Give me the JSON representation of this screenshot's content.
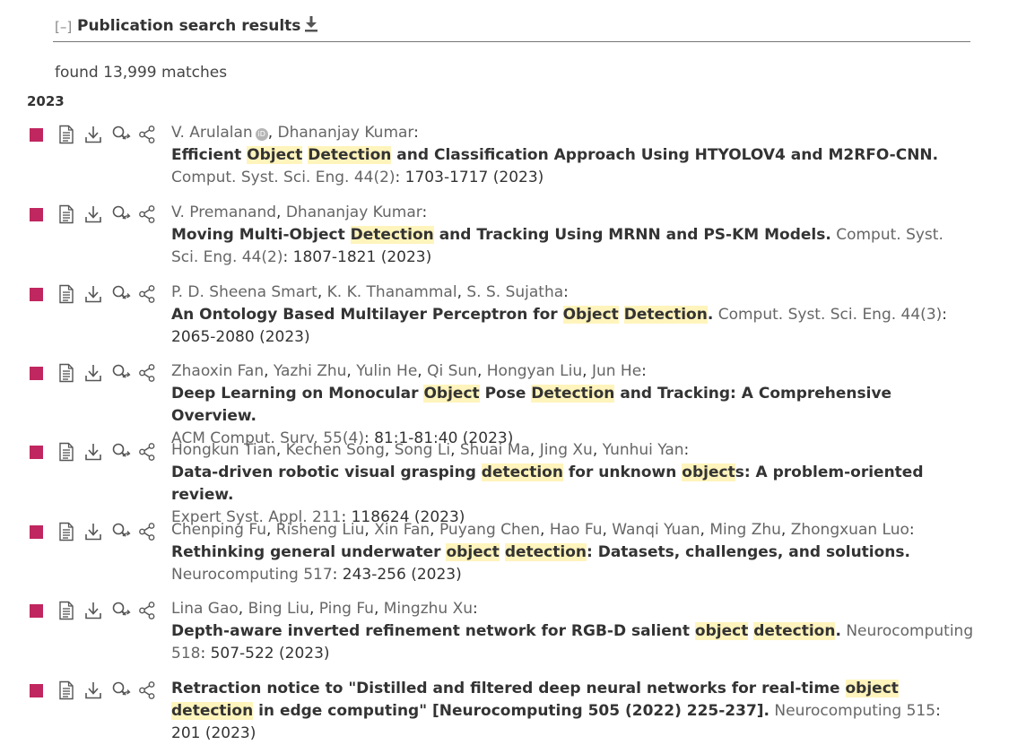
{
  "header": {
    "toggle": "[–]",
    "title": "Publication search results"
  },
  "count_text": "found 13,999 matches",
  "year": "2023",
  "icons": {
    "marker": "journal-article-marker",
    "tools": [
      "document-icon",
      "download-icon",
      "search-link-icon",
      "share-icon"
    ],
    "header_download": "download-icon",
    "orcid": "orcid-icon"
  },
  "colors": {
    "marker": "#c0265f",
    "highlight": "#fff4bc"
  },
  "entries": [
    {
      "authors": [
        {
          "name": "V. Arulalan",
          "sep": "",
          "orcid": true
        },
        {
          "name": "Dhananjay Kumar",
          "sep": ", ",
          "orcid": false
        }
      ],
      "title_parts": [
        {
          "t": "Efficient ",
          "hl": false
        },
        {
          "t": "Object",
          "hl": true
        },
        {
          "t": " ",
          "hl": false
        },
        {
          "t": "Detection",
          "hl": true
        },
        {
          "t": " and Classification Approach Using HTYOLOV4 and M2RFO-CNN.",
          "hl": false
        }
      ],
      "title_break": true,
      "venue": "Comput. Syst. Sci. Eng. 44(2)",
      "pages": ": 1703-1717 (2023)"
    },
    {
      "authors": [
        {
          "name": "V. Premanand",
          "sep": "",
          "orcid": false
        },
        {
          "name": "Dhananjay Kumar",
          "sep": ", ",
          "orcid": false
        }
      ],
      "title_parts": [
        {
          "t": "Moving Multi-Object ",
          "hl": false
        },
        {
          "t": "Detection",
          "hl": true
        },
        {
          "t": " and Tracking Using MRNN and PS-KM Models.",
          "hl": false
        }
      ],
      "title_break": false,
      "venue": "Comput. Syst. Sci. Eng. 44(2)",
      "pages": ": 1807-1821 (2023)"
    },
    {
      "authors": [
        {
          "name": "P. D. Sheena Smart",
          "sep": "",
          "orcid": false
        },
        {
          "name": "K. K. Thanammal",
          "sep": ", ",
          "orcid": false
        },
        {
          "name": "S. S. Sujatha",
          "sep": ", ",
          "orcid": false
        }
      ],
      "title_parts": [
        {
          "t": "An Ontology Based Multilayer Perceptron for ",
          "hl": false
        },
        {
          "t": "Object",
          "hl": true
        },
        {
          "t": " ",
          "hl": false
        },
        {
          "t": "Detection",
          "hl": true
        },
        {
          "t": ".",
          "hl": false
        }
      ],
      "title_break": false,
      "venue": "Comput. Syst. Sci. Eng. 44(3)",
      "pages": ": 2065-2080 (2023)"
    },
    {
      "authors": [
        {
          "name": "Zhaoxin Fan",
          "sep": "",
          "orcid": false
        },
        {
          "name": "Yazhi Zhu",
          "sep": ", ",
          "orcid": false
        },
        {
          "name": "Yulin He",
          "sep": ", ",
          "orcid": false
        },
        {
          "name": "Qi Sun",
          "sep": ", ",
          "orcid": false
        },
        {
          "name": "Hongyan Liu",
          "sep": ", ",
          "orcid": false
        },
        {
          "name": "Jun He",
          "sep": ", ",
          "orcid": false
        }
      ],
      "title_parts": [
        {
          "t": "Deep Learning on Monocular ",
          "hl": false
        },
        {
          "t": "Object",
          "hl": true
        },
        {
          "t": " Pose ",
          "hl": false
        },
        {
          "t": "Detection",
          "hl": true
        },
        {
          "t": " and Tracking: A Comprehensive Overview.",
          "hl": false
        }
      ],
      "title_break": true,
      "venue": "ACM Comput. Surv. 55(4)",
      "pages": ": 81:1-81:40 (2023)"
    },
    {
      "authors": [
        {
          "name": "Hongkun Tian",
          "sep": "",
          "orcid": false
        },
        {
          "name": "Kechen Song",
          "sep": ", ",
          "orcid": false
        },
        {
          "name": "Song Li",
          "sep": ", ",
          "orcid": false
        },
        {
          "name": "Shuai Ma",
          "sep": ", ",
          "orcid": false
        },
        {
          "name": "Jing Xu",
          "sep": ", ",
          "orcid": false
        },
        {
          "name": "Yunhui Yan",
          "sep": ", ",
          "orcid": false
        }
      ],
      "title_parts": [
        {
          "t": "Data-driven robotic visual grasping ",
          "hl": false
        },
        {
          "t": "detection",
          "hl": true
        },
        {
          "t": " for unknown ",
          "hl": false
        },
        {
          "t": "object",
          "hl": true
        },
        {
          "t": "s: A problem-oriented review.",
          "hl": false
        }
      ],
      "title_break": true,
      "venue": "Expert Syst. Appl. 211",
      "pages": ": 118624 (2023)"
    },
    {
      "authors": [
        {
          "name": "Chenping Fu",
          "sep": "",
          "orcid": false
        },
        {
          "name": "Risheng Liu",
          "sep": ", ",
          "orcid": false
        },
        {
          "name": "Xin Fan",
          "sep": ", ",
          "orcid": false
        },
        {
          "name": "Puyang Chen",
          "sep": ", ",
          "orcid": false
        },
        {
          "name": "Hao Fu",
          "sep": ", ",
          "orcid": false
        },
        {
          "name": "Wanqi Yuan",
          "sep": ", ",
          "orcid": false
        },
        {
          "name": "Ming Zhu",
          "sep": ", ",
          "orcid": false
        },
        {
          "name": "Zhongxuan Luo",
          "sep": ", ",
          "orcid": false
        }
      ],
      "title_parts": [
        {
          "t": "Rethinking general underwater ",
          "hl": false
        },
        {
          "t": "object",
          "hl": true
        },
        {
          "t": " ",
          "hl": false
        },
        {
          "t": "detection",
          "hl": true
        },
        {
          "t": ": Datasets, challenges, and solutions.",
          "hl": false
        }
      ],
      "title_break": true,
      "venue": "Neurocomputing 517",
      "pages": ": 243-256 (2023)"
    },
    {
      "authors": [
        {
          "name": "Lina Gao",
          "sep": "",
          "orcid": false
        },
        {
          "name": "Bing Liu",
          "sep": ", ",
          "orcid": false
        },
        {
          "name": "Ping Fu",
          "sep": ", ",
          "orcid": false
        },
        {
          "name": "Mingzhu Xu",
          "sep": ", ",
          "orcid": false
        }
      ],
      "title_parts": [
        {
          "t": "Depth-aware inverted refinement network for RGB-D salient ",
          "hl": false
        },
        {
          "t": "object",
          "hl": true
        },
        {
          "t": " ",
          "hl": false
        },
        {
          "t": "detection",
          "hl": true
        },
        {
          "t": ".",
          "hl": false
        }
      ],
      "title_break": false,
      "venue": "Neurocomputing 518",
      "pages": ": 507-522 (2023)"
    },
    {
      "authors": [],
      "title_parts": [
        {
          "t": "Retraction notice to \"Distilled and filtered deep neural networks for real-time ",
          "hl": false
        },
        {
          "t": "object",
          "hl": true
        },
        {
          "t": " ",
          "hl": false
        },
        {
          "t": "detection",
          "hl": true
        },
        {
          "t": " in edge computing\" [Neurocomputing 505 (2022) 225-237].",
          "hl": false
        }
      ],
      "title_break": false,
      "venue": "Neurocomputing 515",
      "pages": ": 201 (2023)"
    }
  ]
}
